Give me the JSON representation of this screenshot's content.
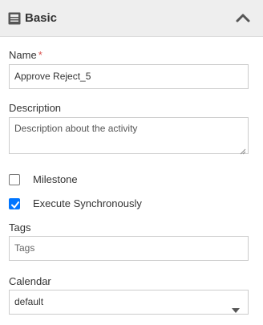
{
  "panel": {
    "title": "Basic",
    "icon": "layout-icon",
    "collapse_icon": "chevron-up-icon"
  },
  "form": {
    "name": {
      "label": "Name",
      "required_mark": "*",
      "value": "Approve Reject_5"
    },
    "description": {
      "label": "Description",
      "value": "Description about the activity"
    },
    "milestone": {
      "label": "Milestone",
      "checked": false
    },
    "execute_sync": {
      "label": "Execute Synchronously",
      "checked": true
    },
    "tags": {
      "label": "Tags",
      "placeholder": "Tags"
    },
    "calendar": {
      "label": "Calendar",
      "value": "default"
    }
  },
  "colors": {
    "header_bg": "#eeeeee",
    "checkbox_accent": "#0075ff",
    "required": "#d9534f"
  }
}
